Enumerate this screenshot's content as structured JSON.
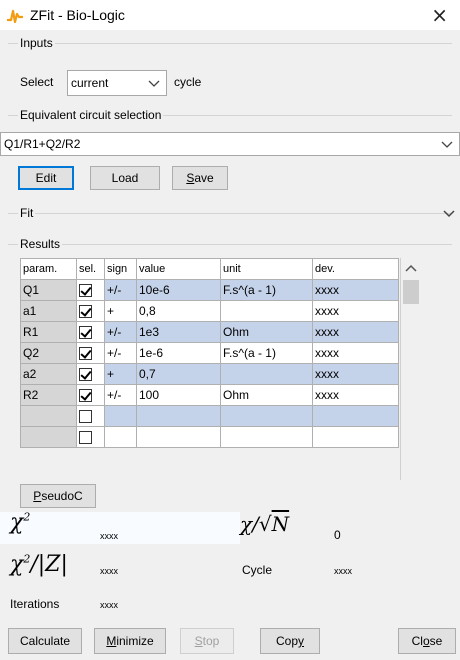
{
  "window": {
    "title": "ZFit - Bio-Logic",
    "close_label": "×"
  },
  "inputs": {
    "group_label": "Inputs",
    "select_label": "Select",
    "select_value": "current",
    "select_suffix": "cycle"
  },
  "circuit": {
    "group_label": "Equivalent circuit selection",
    "value": "Q1/R1+Q2/R2",
    "buttons": {
      "edit": "Edit",
      "load": "Load",
      "save_prefix": "",
      "save_underline": "S",
      "save_rest": "ave"
    }
  },
  "fit": {
    "group_label": "Fit"
  },
  "results": {
    "group_label": "Results",
    "columns": [
      "param.",
      "sel.",
      "sign",
      "value",
      "unit",
      "dev."
    ],
    "rows": [
      {
        "param": "Q1",
        "checked": true,
        "sign": "+/-",
        "value": "10e-6",
        "unit": "F.s^(a - 1)",
        "dev": "xxxx",
        "style": "blue"
      },
      {
        "param": "a1",
        "checked": true,
        "sign": "+",
        "value": "0,8",
        "unit": "",
        "dev": "xxxx",
        "style": "white"
      },
      {
        "param": "R1",
        "checked": true,
        "sign": "+/-",
        "value": "1e3",
        "unit": "Ohm",
        "dev": "xxxx",
        "style": "blue"
      },
      {
        "param": "Q2",
        "checked": true,
        "sign": "+/-",
        "value": "1e-6",
        "unit": "F.s^(a - 1)",
        "dev": "xxxx",
        "style": "white"
      },
      {
        "param": "a2",
        "checked": true,
        "sign": "+",
        "value": "0,7",
        "unit": "",
        "dev": "xxxx",
        "style": "blue"
      },
      {
        "param": "R2",
        "checked": true,
        "sign": "+/-",
        "value": "100",
        "unit": "Ohm",
        "dev": "xxxx",
        "style": "white"
      },
      {
        "param": "",
        "checked": false,
        "sign": "",
        "value": "",
        "unit": "",
        "dev": "",
        "style": "blue"
      },
      {
        "param": "",
        "checked": false,
        "sign": "",
        "value": "",
        "unit": "",
        "dev": "",
        "style": "white"
      }
    ],
    "pseudoc": {
      "underline": "P",
      "rest": "seudoC"
    }
  },
  "stats": {
    "chi2_value": "xxxx",
    "chi_sqrtn_value": "0",
    "chi2_z_value": "xxxx",
    "cycle_label": "Cycle",
    "cycle_value": "xxxx",
    "iterations_label": "Iterations",
    "iterations_value": "xxxx"
  },
  "footer": {
    "calculate": "Calculate",
    "minimize_underline": "M",
    "minimize_rest": "inimize",
    "stop_underline": "S",
    "stop_rest": "top",
    "copy_prefix": "Cop",
    "copy_underline": "y",
    "close_prefix": "Cl",
    "close_underline": "o",
    "close_rest": "se"
  },
  "colors": {
    "row_blue": "#c5d3ea",
    "focus_blue": "#0078d7",
    "param_gray": "#d6d6d6"
  }
}
